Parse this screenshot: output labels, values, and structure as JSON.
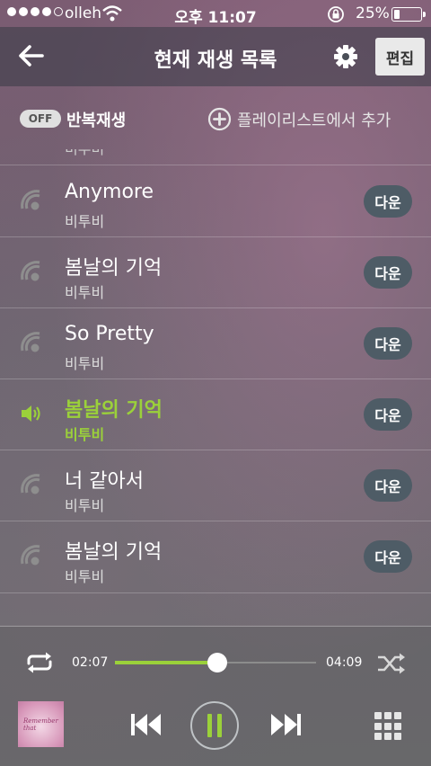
{
  "status_bar": {
    "carrier": "olleh",
    "time": "오후 11:07",
    "battery": "25%"
  },
  "header": {
    "title": "현재 재생 목록",
    "edit_label": "편집"
  },
  "options": {
    "repeat_toggle": "OFF",
    "repeat_label": "반복재생",
    "add_label": "플레이리스트에서 추가"
  },
  "list": {
    "partial_artist": "비투비",
    "rows": [
      {
        "title": "Anymore",
        "artist": "비투비",
        "download": "다운"
      },
      {
        "title": "봄날의 기억",
        "artist": "비투비",
        "download": "다운"
      },
      {
        "title": "So Pretty",
        "artist": "비투비",
        "download": "다운"
      },
      {
        "title": "봄날의 기억",
        "artist": "비투비",
        "download": "다운",
        "playing": true
      },
      {
        "title": "너 같아서",
        "artist": "비투비",
        "download": "다운"
      },
      {
        "title": "봄날의 기억",
        "artist": "비투비",
        "download": "다운"
      }
    ]
  },
  "player": {
    "elapsed": "02:07",
    "total": "04:09",
    "progress_fraction": 0.508,
    "album_art_text": "Remember that"
  },
  "colors": {
    "accent": "#9bd13a",
    "download_button": "#4e5c66"
  },
  "icons": [
    "back-arrow-icon",
    "gear-icon",
    "add-circle-icon",
    "sound-icon",
    "speaker-icon",
    "repeat-icon",
    "shuffle-icon",
    "previous-icon",
    "pause-icon",
    "next-icon",
    "grid-icon"
  ]
}
